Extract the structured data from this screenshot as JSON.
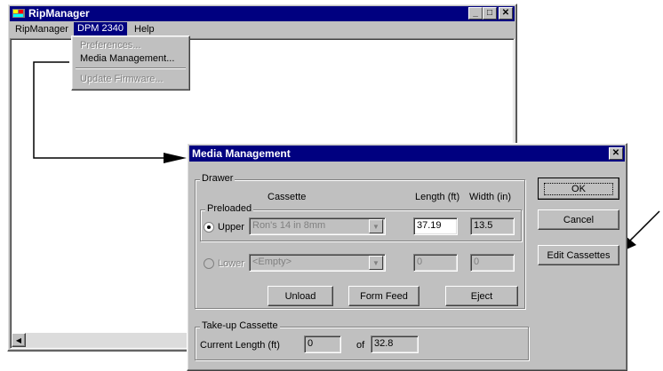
{
  "main_window": {
    "title": "RipManager",
    "menu": [
      "RipManager",
      "DPM 2340",
      "Help"
    ]
  },
  "dpm_menu": {
    "items": [
      {
        "label": "Preferences...",
        "enabled": false
      },
      {
        "label": "Media Management...",
        "enabled": true
      },
      {
        "label": "Update Firmware...",
        "enabled": false
      }
    ]
  },
  "dialog": {
    "title": "Media Management",
    "drawer": {
      "legend": "Drawer",
      "col_cassette": "Cassette",
      "col_length": "Length (ft)",
      "col_width": "Width (in)",
      "preloaded_legend": "Preloaded",
      "upper": {
        "label": "Upper",
        "selected": true,
        "cassette": "Ron's 14 in 8mm",
        "length": "37.19",
        "width": "13.5"
      },
      "lower": {
        "label": "Lower",
        "selected": false,
        "cassette": "<Empty>",
        "length": "0",
        "width": "0"
      },
      "buttons": {
        "unload": "Unload",
        "form_feed": "Form Feed",
        "eject": "Eject"
      }
    },
    "takeup": {
      "legend": "Take-up Cassette",
      "current_label": "Current Length (ft)",
      "current_value": "0",
      "of_label": "of",
      "total_value": "32.8"
    },
    "buttons": {
      "ok": "OK",
      "cancel": "Cancel",
      "edit": "Edit Cassettes"
    }
  },
  "colors": {
    "titlebar": "#000080",
    "face": "#c0c0c0",
    "highlight": "#000080"
  }
}
